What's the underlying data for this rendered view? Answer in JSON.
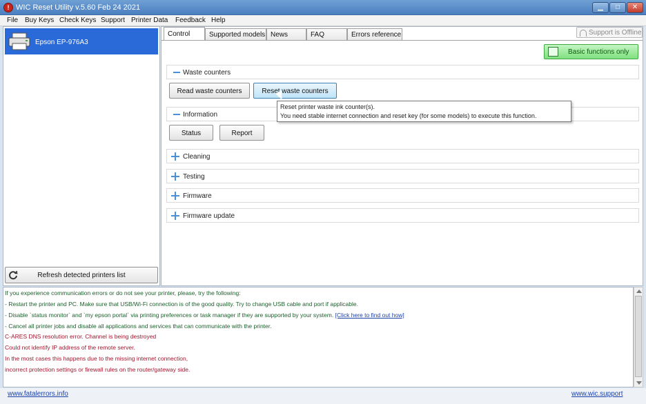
{
  "window": {
    "title": "WIC Reset Utility v.5.60 Feb 24 2021",
    "app_icon_glyph": "!",
    "min_glyph": "▁",
    "max_glyph": "□",
    "close_glyph": "✕"
  },
  "menu": [
    "File",
    "Buy Keys",
    "Check Keys",
    "Support",
    "Printer Data",
    "Feedback",
    "Help"
  ],
  "printers": {
    "items": [
      {
        "label": "Epson EP-976A3",
        "selected": true,
        "icon": "printer-icon"
      }
    ],
    "refresh_label": "Refresh detected printers list"
  },
  "tabs": [
    {
      "label": "Control",
      "active": true
    },
    {
      "label": "Supported models",
      "active": false
    },
    {
      "label": "News",
      "active": false
    },
    {
      "label": "FAQ",
      "active": false
    },
    {
      "label": "Errors reference",
      "active": false
    }
  ],
  "support_status": "Support is Offline",
  "basic_functions_label": "Basic functions only",
  "sections": {
    "waste": {
      "label": "Waste counters",
      "expanded": true
    },
    "info": {
      "label": "Information",
      "expanded": true
    },
    "cleaning": {
      "label": "Cleaning",
      "expanded": false
    },
    "testing": {
      "label": "Testing",
      "expanded": false
    },
    "firmware": {
      "label": "Firmware",
      "expanded": false
    },
    "firmware_update": {
      "label": "Firmware update",
      "expanded": false
    }
  },
  "buttons": {
    "read_waste": "Read waste counters",
    "reset_waste": "Reset waste counters",
    "status": "Status",
    "report": "Report"
  },
  "tooltip": {
    "line1": "Reset printer waste ink counter(s).",
    "line2": "You need stable internet connection and reset key (for some models) to execute this function."
  },
  "log": {
    "info_lines": [
      "If you experience communication errors or do not see your printer, please, try the following:",
      "- Restart the printer and PC. Make sure that USB/Wi-Fi connection is of the good quality. Try to change USB cable and port if applicable.",
      "- Disable `status monitor` and `my epson portal` via printing preferences or task manager if they are supported by your system. ",
      "- Cancel all printer jobs and disable all applications and services that can communicate with the printer."
    ],
    "info_link": "[Click here to find out how]",
    "error_lines": [
      "C-ARES DNS resolution error. Channel is being destroyed",
      "Could not identify IP address of the remote server.",
      "In the most cases this happens due to the missing internet connection,",
      "incorrect protection settings or firewall rules on the router/gateway side."
    ]
  },
  "status_bar": {
    "left_link": "www.fatalerrors.info",
    "right_link": "www.wic.support"
  }
}
